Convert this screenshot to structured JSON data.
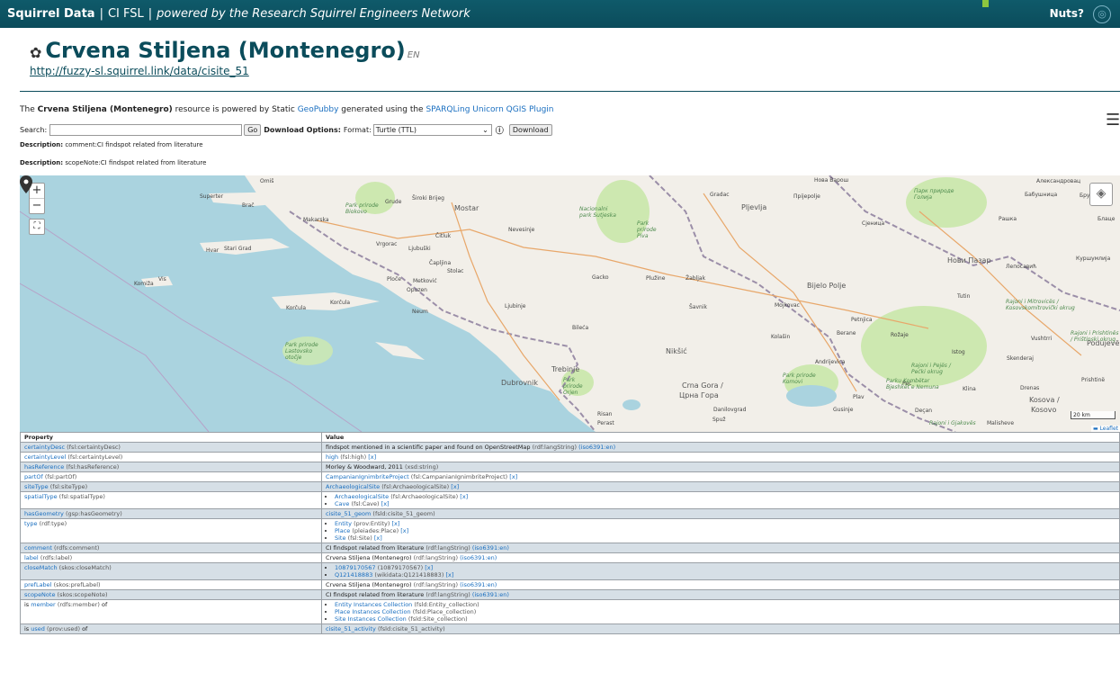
{
  "topbar": {
    "brand": "Squirrel Data",
    "section": "CI FSL",
    "tagline": "powered by the Research Squirrel Engineers Network",
    "nuts": "Nuts?"
  },
  "header": {
    "title": "Crvena Stiljena (Montenegro)",
    "lang": "EN",
    "uri": "http://fuzzy-sl.squirrel.link/data/cisite_51"
  },
  "powered": {
    "before": "The ",
    "resource": "Crvena Stiljena (Montenegro)",
    "middle": " resource is powered by Static ",
    "geopubby": "GeoPubby",
    "middle2": " generated using the ",
    "plugin": "SPARQLing Unicorn QGIS Plugin"
  },
  "search": {
    "label": "Search:",
    "value": "",
    "go": "Go",
    "download_options": "Download Options:",
    "format_label": "Format:",
    "format_value": "Turtle (TTL)",
    "info": "ⓘ",
    "download": "Download"
  },
  "descriptions": [
    {
      "label": "Description:",
      "text": "comment:CI findspot related from literature"
    },
    {
      "label": "Description:",
      "text": "scopeNote:CI findspot related from literature"
    }
  ],
  "map": {
    "zoom_in": "+",
    "zoom_out": "−",
    "fullscreen": "⛶",
    "scale": "20 km",
    "attribution": "Leaflet",
    "labels": [
      "Superter",
      "Brač",
      "Omiš",
      "Makarska",
      "Hvar",
      "Stari Grad",
      "Komiža",
      "Vis",
      "Korčula",
      "Korčula",
      "Grude",
      "Široki Brijeg",
      "Mostar",
      "Čitluk",
      "Ljubuški",
      "Vrgorac",
      "Čapljina",
      "Stolac",
      "Ploče",
      "Metković",
      "Opuzen",
      "Neum",
      "Ljubinje",
      "Nevesinje",
      "Gacko",
      "Bileća",
      "Trebinje",
      "Dubrovnik",
      "Risan",
      "Perast",
      "Nikšić",
      "Plužine",
      "Žabljak",
      "Šavnik",
      "Pljevlja",
      "Gradac",
      "Прijepolje",
      "Bijelo Polje",
      "Mojkovac",
      "Kolašin",
      "Berane",
      "Rožaje",
      "Andrijevica",
      "Petnjica",
      "Plav",
      "Gusinje",
      "Danilovgrad",
      "Spuž",
      "Crna Gora /",
      "Црна Гора",
      "Нова Варош",
      "Сјеница",
      "Нови Пазар",
      "Tutin",
      "Istog",
      "Peć",
      "Klina",
      "Drenas",
      "Kosova /",
      "Kosovo",
      "Podujevë",
      "Prishtinë",
      "Deçan",
      "Rajoni i Gjakovës",
      "Malisheve",
      "Vushtrri",
      "Skenderaj",
      "Лепосавић",
      "Рашка",
      "Брус",
      "Бабушница",
      "Блаце",
      "Александровац",
      "Куршумлија",
      "Park prirode Biokovo",
      "Park prirode Lastovsko otočje",
      "Nacionalni park Sutjeska",
      "Park prirode Piva",
      "Park prirode Komovi",
      "Parku Kombëtar Bjeshkët e Nemuna",
      "Rajoni i Mitrovicës / Kosovskomitrovički okrug",
      "Rajoni i Pejës / Pećki okrug",
      "Rajoni i Prishtinës / Prištinski okrug",
      "Park prirode Orjen",
      "Парк природе Голија"
    ]
  },
  "table": {
    "headers": [
      "Property",
      "Value"
    ],
    "rows": [
      {
        "prop": "certaintyDesc",
        "propq": "(fsl:certaintyDesc)",
        "value": "findspot mentioned in a scientific paper and found on OpenStreetMap",
        "valueq": "(rdf:langString)",
        "extra": "(iso6391:en)"
      },
      {
        "prop": "certaintyLevel",
        "propq": "(fsl:certaintyLevel)",
        "value": "high",
        "valueq": "(fsl:high)",
        "extra": "[x]"
      },
      {
        "prop": "hasReference",
        "propq": "(fsl:hasReference)",
        "value": "Morley & Woodward, 2011",
        "valueq": "(xsd:string)",
        "extra": ""
      },
      {
        "prop": "partOf",
        "propq": "(fsl:partOf)",
        "value": "CampanianIgnimbriteProject",
        "valueq": "(fsl:CampanianIgnimbriteProject)",
        "extra": "[x]"
      },
      {
        "prop": "siteType",
        "propq": "(fsl:siteType)",
        "value": "ArchaeologicalSite",
        "valueq": "(fsl:ArchaeologicalSite)",
        "extra": "[x]"
      },
      {
        "prop": "spatialType",
        "propq": "(fsl:spatialType)",
        "list": [
          {
            "value": "ArchaeologicalSite",
            "valueq": "(fsl:ArchaeologicalSite)",
            "extra": "[x]"
          },
          {
            "value": "Cave",
            "valueq": "(fsl:Cave)",
            "extra": "[x]"
          }
        ]
      },
      {
        "prop": "hasGeometry",
        "propq": "(gsp:hasGeometry)",
        "value": "cisite_51_geom",
        "valueq": "(fsld:cisite_51_geom)",
        "extra": ""
      },
      {
        "prop": "type",
        "propq": "(rdf:type)",
        "list": [
          {
            "value": "Entity",
            "valueq": "(prov:Entity)",
            "extra": "[x]"
          },
          {
            "value": "Place",
            "valueq": "(pleiades:Place)",
            "extra": "[x]"
          },
          {
            "value": "Site",
            "valueq": "(fsl:Site)",
            "extra": "[x]"
          }
        ]
      },
      {
        "prop": "comment",
        "propq": "(rdfs:comment)",
        "value": "CI findspot related from literature",
        "valueq": "(rdf:langString)",
        "extra": "(iso6391:en)"
      },
      {
        "prop": "label",
        "propq": "(rdfs:label)",
        "value": "Crvena Stiljena (Montenegro)",
        "valueq": "(rdf:langString)",
        "extra": "(iso6391:en)"
      },
      {
        "prop": "closeMatch",
        "propq": "(skos:closeMatch)",
        "list": [
          {
            "value": "10879170567",
            "valueq": "(10879170567)",
            "extra": "[x]"
          },
          {
            "value": "Q121418883",
            "valueq": "(wikidata:Q121418883)",
            "extra": "[x]"
          }
        ]
      },
      {
        "prop": "prefLabel",
        "propq": "(skos:prefLabel)",
        "value": "Crvena Stiljena (Montenegro)",
        "valueq": "(rdf:langString)",
        "extra": "(iso6391:en)"
      },
      {
        "prop": "scopeNote",
        "propq": "(skos:scopeNote)",
        "value": "CI findspot related from literature",
        "valueq": "(rdf:langString)",
        "extra": "(iso6391:en)"
      },
      {
        "prefix": "is ",
        "prop": "member",
        "propq": "(rdfs:member)",
        "suffix": " of",
        "list": [
          {
            "value": "Entity Instances Collection",
            "valueq": "(fsld:Entity_collection)",
            "extra": ""
          },
          {
            "value": "Place Instances Collection",
            "valueq": "(fsld:Place_collection)",
            "extra": ""
          },
          {
            "value": "Site Instances Collection",
            "valueq": "(fsld:Site_collection)",
            "extra": ""
          }
        ]
      },
      {
        "prefix": "is ",
        "prop": "used",
        "propq": "(prov:used)",
        "suffix": " of",
        "value": "cisite_51_activity",
        "valueq": "(fsld:cisite_51_activity)",
        "extra": ""
      }
    ]
  }
}
